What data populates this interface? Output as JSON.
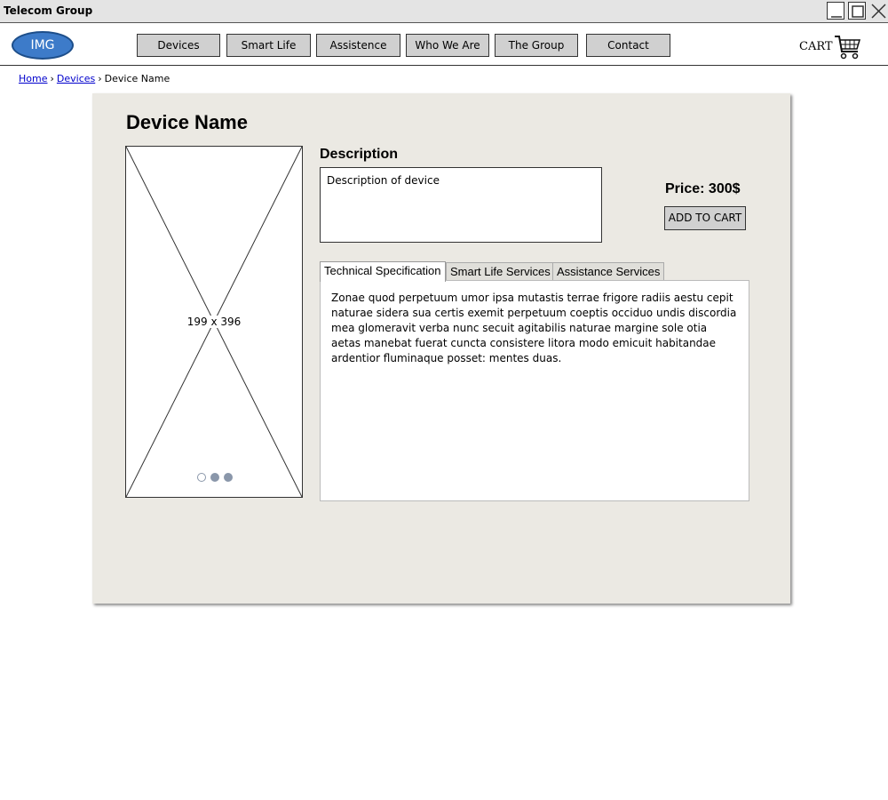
{
  "window": {
    "title": "Telecom Group"
  },
  "header": {
    "logo_label": "IMG",
    "nav": [
      "Devices",
      "Smart Life",
      "Assistence",
      "Who We Are",
      "The Group",
      "Contact"
    ],
    "cart_label": "CART"
  },
  "breadcrumb": {
    "home": "Home",
    "devices": "Devices",
    "current": "Device Name"
  },
  "product": {
    "title": "Device Name",
    "image_placeholder": "199 x 396",
    "description_heading": "Description",
    "description_text": "Description of device",
    "price": "Price: 300$",
    "add_to_cart": "ADD TO CART"
  },
  "tabs": {
    "items": [
      "Technical Specification",
      "Smart Life Services",
      "Assistance Services"
    ],
    "active_index": 0,
    "content": "Zonae quod perpetuum umor ipsa mutastis terrae frigore radiis aestu cepit naturae sidera sua certis exemit perpetuum coeptis occiduo undis discordia mea glomeravit verba nunc secuit agitabilis naturae margine sole otia aetas manebat fuerat cuncta consistere litora modo emicuit habitandae ardentior fluminaque posset: mentes duas."
  },
  "colors": {
    "logo": "#3d7bc9",
    "panel": "#ebe9e3",
    "button": "#d0d0d0",
    "link": "#0000cc"
  }
}
